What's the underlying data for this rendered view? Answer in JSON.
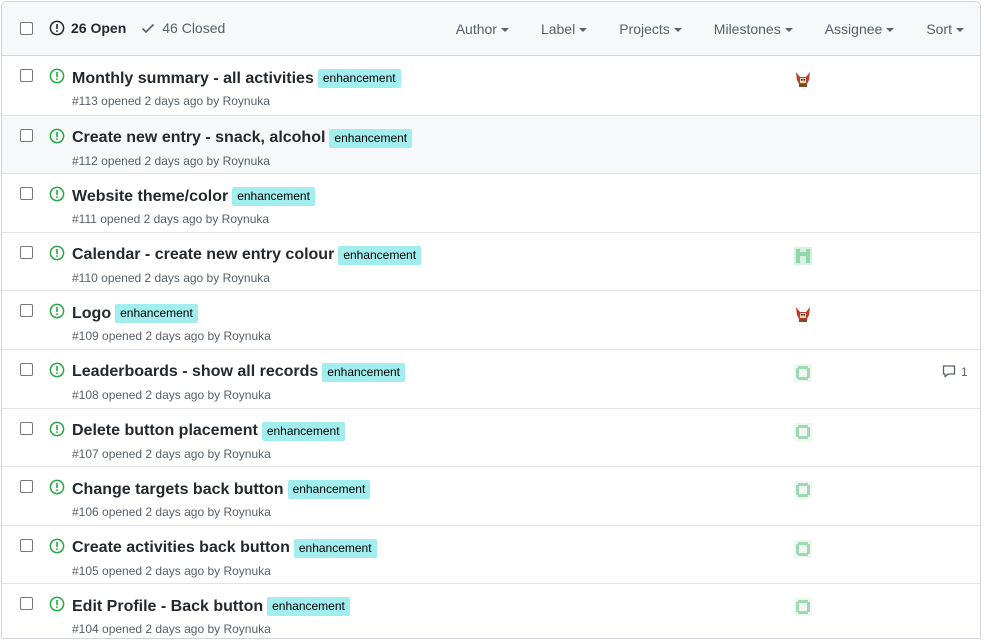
{
  "header": {
    "open_count": "26 Open",
    "closed_count": "46 Closed",
    "filters": [
      "Author",
      "Label",
      "Projects",
      "Milestones",
      "Assignee",
      "Sort"
    ]
  },
  "colors": {
    "open_icon": "#28a745",
    "label_bg": "#a2eeef",
    "avatar_fox": "#c0392b",
    "avatar_green": "#9fd9b4"
  },
  "issues": [
    {
      "title": "Monthly summary - all activities",
      "label": "enhancement",
      "meta": "#113 opened 2 days ago by Roynuka",
      "avatar": "fox-avatar",
      "comments": ""
    },
    {
      "title": "Create new entry - snack, alcohol",
      "label": "enhancement",
      "meta": "#112 opened 2 days ago by Roynuka",
      "avatar": "",
      "comments": ""
    },
    {
      "title": "Website theme/color",
      "label": "enhancement",
      "meta": "#111 opened 2 days ago by Roynuka",
      "avatar": "",
      "comments": ""
    },
    {
      "title": "Calendar - create new entry colour",
      "label": "enhancement",
      "meta": "#110 opened 2 days ago by Roynuka",
      "avatar": "m-avatar",
      "comments": ""
    },
    {
      "title": "Logo",
      "label": "enhancement",
      "meta": "#109 opened 2 days ago by Roynuka",
      "avatar": "fox-avatar",
      "comments": ""
    },
    {
      "title": "Leaderboards - show all records",
      "label": "enhancement",
      "meta": "#108 opened 2 days ago by Roynuka",
      "avatar": "ring-avatar",
      "comments": "1"
    },
    {
      "title": "Delete button placement",
      "label": "enhancement",
      "meta": "#107 opened 2 days ago by Roynuka",
      "avatar": "ring-avatar",
      "comments": ""
    },
    {
      "title": "Change targets back button",
      "label": "enhancement",
      "meta": "#106 opened 2 days ago by Roynuka",
      "avatar": "ring-avatar",
      "comments": ""
    },
    {
      "title": "Create activities back button",
      "label": "enhancement",
      "meta": "#105 opened 2 days ago by Roynuka",
      "avatar": "ring-avatar",
      "comments": ""
    },
    {
      "title": "Edit Profile - Back button",
      "label": "enhancement",
      "meta": "#104 opened 2 days ago by Roynuka",
      "avatar": "ring-avatar",
      "comments": ""
    }
  ]
}
